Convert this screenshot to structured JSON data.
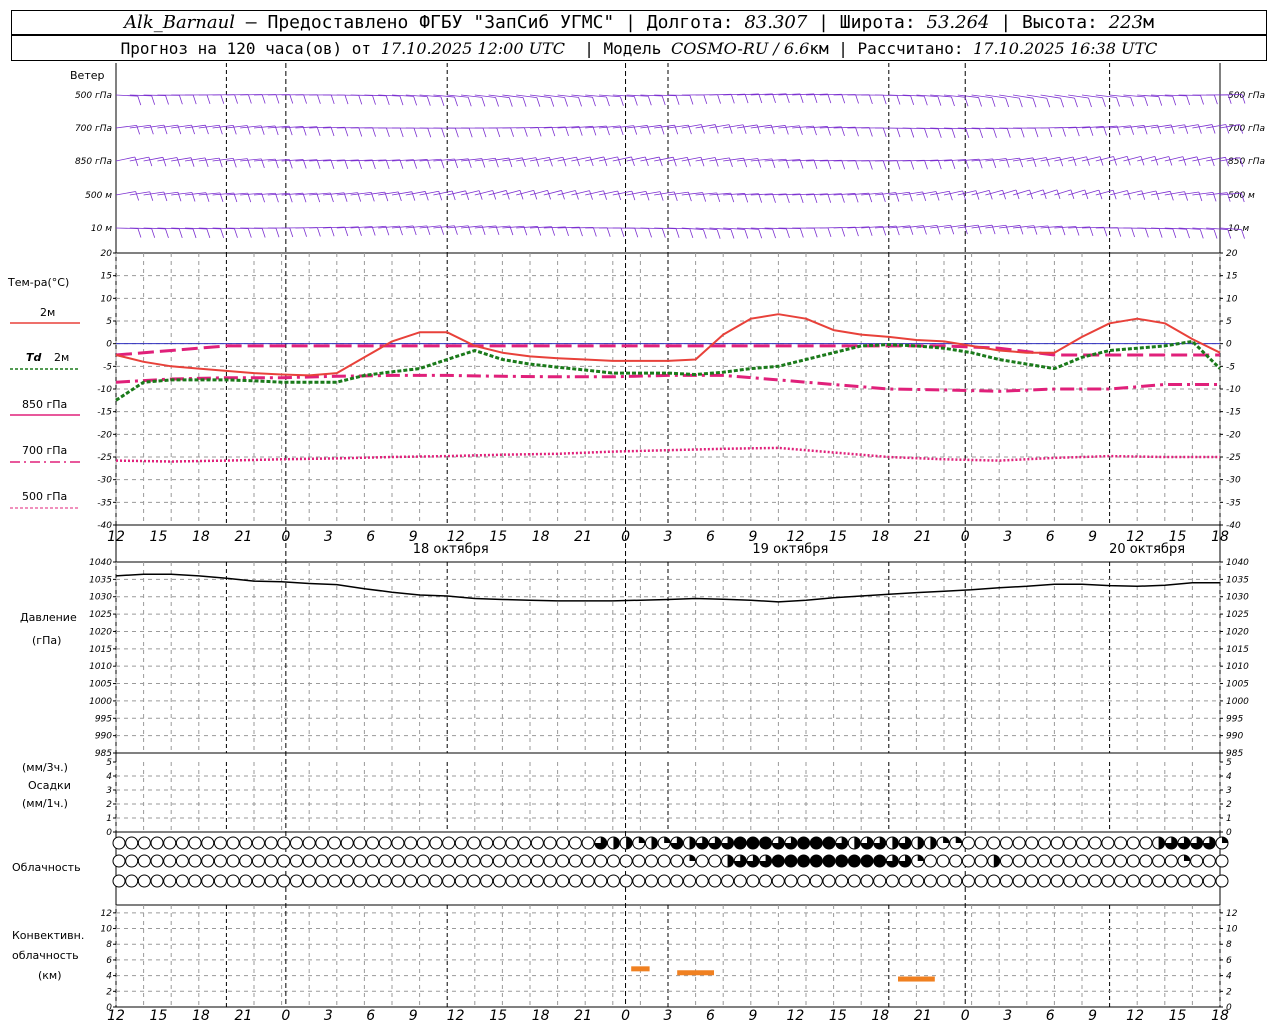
{
  "header": {
    "station": "Alk_Barnaul",
    "provider": " — Предоставлено ФГБУ \"ЗапСиб УГМС\" | Долгота: ",
    "lon": "83.307",
    "lat_label": " | Широта: ",
    "lat": "53.264",
    "alt_label": " | Высота: ",
    "alt": "223",
    "alt_unit": "м",
    "forecast_label": "Прогноз на 120 часа(ов) от ",
    "forecast_from": "17.10.2025 12:00 UTC",
    "model_label": "  | Модель ",
    "model": "COSMO-RU / 6.6",
    "model_unit": "км",
    "calc_label": " | Рассчитано: ",
    "calc_time": "17.10.2025 16:38 UTC"
  },
  "labels": {
    "wind": "Ветер",
    "wind_levels": [
      "500 гПа",
      "700 гПа",
      "850 гПа",
      "500 м",
      "10  м"
    ],
    "temp": "Тем-ра(°C)",
    "t2m": "2м",
    "td_a": "Td",
    "td_b": "2м",
    "t850": "850 гПа",
    "t700": "700 гПа",
    "t500": "500 гПа",
    "pressure": "Давление",
    "pressure_unit": "(гПа)",
    "precip_top": "(мм/3ч.)",
    "precip": "Осадки",
    "precip_unit": "(мм/1ч.)",
    "cloud": "Облачность",
    "conv1": "Конвективн.",
    "conv2": "облачность",
    "conv3": "(км)"
  },
  "colors": {
    "wind": "#7b2fd0",
    "t2m": "#e8413a",
    "td": "#1a7a1a",
    "t850": "#e0207a",
    "t700": "#e0207a",
    "t500": "#e0207a",
    "zero": "#3030c0",
    "pressure": "#000000",
    "conv": "#f08020"
  },
  "chart_data": {
    "type": "line",
    "x_hours": [
      12,
      15,
      18,
      21,
      0,
      3,
      6,
      9,
      12,
      15,
      18,
      21,
      0,
      3,
      6,
      9,
      12,
      15,
      18,
      21,
      0,
      3,
      6,
      9,
      12,
      15,
      18
    ],
    "dates": [
      "18 октября",
      "19 октября",
      "20 октября"
    ],
    "temperature": {
      "ylim": [
        -40,
        20
      ],
      "ticks": [
        20,
        15,
        10,
        5,
        0,
        -5,
        -10,
        -15,
        -20,
        -25,
        -30,
        -35,
        -40
      ],
      "series": [
        {
          "name": "2м",
          "x": [
            0,
            3,
            6,
            9,
            12,
            15,
            18,
            21,
            24,
            27,
            30,
            33,
            36,
            39,
            42,
            45,
            48,
            51,
            54,
            57,
            60,
            63,
            66,
            69,
            72,
            75,
            78,
            81,
            84,
            87,
            90,
            93,
            96,
            99,
            102,
            105,
            108,
            111,
            114,
            117,
            120
          ],
          "values": [
            -2.5,
            -4,
            -5,
            -5.5,
            -6,
            -6.5,
            -6.8,
            -7,
            -6.5,
            -3,
            0.5,
            2.5,
            2.5,
            -0.5,
            -2,
            -2.8,
            -3.2,
            -3.5,
            -3.8,
            -3.8,
            -3.8,
            -3.5,
            2,
            5.5,
            6.5,
            5.5,
            3,
            2,
            1.5,
            0.8,
            0.5,
            -0.5,
            -1.5,
            -2,
            -2,
            1.5,
            4.5,
            5.5,
            4.5,
            1,
            -2
          ]
        },
        {
          "name": "Td 2м",
          "x": [
            0,
            3,
            6,
            9,
            12,
            15,
            18,
            21,
            24,
            27,
            30,
            33,
            36,
            39,
            42,
            45,
            48,
            51,
            54,
            57,
            60,
            63,
            66,
            69,
            72,
            75,
            78,
            81,
            84,
            87,
            90,
            93,
            96,
            99,
            102,
            105,
            108,
            111,
            114,
            117,
            120
          ],
          "values": [
            -12.5,
            -8.5,
            -8,
            -8,
            -8,
            -8.2,
            -8.5,
            -8.5,
            -8.5,
            -7,
            -6.2,
            -5.5,
            -3.5,
            -1.5,
            -3.5,
            -4.5,
            -5.2,
            -5.8,
            -6.5,
            -6.5,
            -6.5,
            -6.8,
            -6.3,
            -5.5,
            -5,
            -3.5,
            -2,
            -0.5,
            -0.2,
            -0.5,
            -1,
            -2,
            -3.5,
            -4.5,
            -5.5,
            -3,
            -1.5,
            -1,
            -0.5,
            0.5,
            -5.5
          ]
        },
        {
          "name": "850 гПа",
          "x": [
            0,
            6,
            12,
            18,
            24,
            30,
            36,
            42,
            48,
            54,
            60,
            66,
            72,
            78,
            84,
            90,
            96,
            102,
            108,
            114,
            120
          ],
          "values": [
            -2.5,
            -1.5,
            -0.5,
            -0.5,
            -0.5,
            -0.5,
            -0.5,
            -0.5,
            -0.5,
            -0.5,
            -0.5,
            -0.5,
            -0.5,
            -0.5,
            -0.5,
            -0.5,
            -1,
            -2.5,
            -2.5,
            -2.5,
            -2.5
          ]
        },
        {
          "name": "700 гПа",
          "x": [
            0,
            6,
            12,
            18,
            24,
            30,
            36,
            42,
            48,
            54,
            60,
            66,
            72,
            78,
            84,
            90,
            96,
            102,
            108,
            114,
            120
          ],
          "values": [
            -8.5,
            -7.8,
            -7.5,
            -7.5,
            -7.2,
            -7,
            -7,
            -7.2,
            -7.3,
            -7.3,
            -7,
            -7,
            -8,
            -9,
            -10,
            -10.2,
            -10.5,
            -10,
            -10,
            -9,
            -9
          ]
        },
        {
          "name": "500 гПа",
          "x": [
            0,
            6,
            12,
            18,
            24,
            30,
            36,
            42,
            48,
            54,
            60,
            66,
            72,
            78,
            84,
            90,
            96,
            102,
            108,
            114,
            120
          ],
          "values": [
            -25.8,
            -26,
            -25.8,
            -25.5,
            -25.3,
            -25,
            -24.8,
            -24.5,
            -24.3,
            -23.8,
            -23.5,
            -23.2,
            -23,
            -24,
            -25,
            -25.5,
            -25.8,
            -25.2,
            -24.8,
            -25,
            -25
          ]
        }
      ]
    },
    "pressure": {
      "ylim": [
        985,
        1040
      ],
      "ticks": [
        1040,
        1035,
        1030,
        1025,
        1020,
        1015,
        1010,
        1005,
        1000,
        995,
        990,
        985
      ],
      "series": [
        {
          "name": "",
          "x": [
            0,
            3,
            6,
            9,
            12,
            15,
            18,
            21,
            24,
            27,
            30,
            33,
            36,
            39,
            42,
            45,
            48,
            51,
            54,
            57,
            60,
            63,
            66,
            69,
            72,
            75,
            78,
            81,
            84,
            87,
            90,
            93,
            96,
            99,
            102,
            105,
            108,
            111,
            114,
            117,
            120
          ],
          "values": [
            1036,
            1036.5,
            1036.5,
            1036,
            1035.3,
            1034.5,
            1034.3,
            1033.8,
            1033.5,
            1032.3,
            1031.3,
            1030.5,
            1030.2,
            1029.5,
            1029.2,
            1029,
            1028.8,
            1028.8,
            1028.8,
            1029,
            1029.2,
            1029.5,
            1029.3,
            1029,
            1028.5,
            1029,
            1029.7,
            1030.2,
            1030.7,
            1031.2,
            1031.6,
            1032,
            1032.6,
            1033,
            1033.6,
            1033.6,
            1033.2,
            1033,
            1033.3,
            1034,
            1034
          ]
        }
      ]
    },
    "precip": {
      "ylim": [
        0,
        5
      ],
      "ticks": [
        5,
        4,
        3,
        2,
        1,
        0
      ]
    },
    "convective": {
      "ylim": [
        0,
        13
      ],
      "ticks": [
        12,
        10,
        8,
        6,
        4,
        2,
        0
      ],
      "segments": [
        {
          "x0": 56,
          "x1": 58,
          "y": 4.8
        },
        {
          "x0": 61,
          "x1": 65,
          "y": 4.3
        },
        {
          "x0": 85,
          "x1": 89,
          "y": 3.5
        }
      ]
    },
    "clouds": {
      "rows": 3,
      "count": 81,
      "upper": [
        0,
        0,
        0,
        0,
        0,
        0,
        0,
        0,
        0,
        0,
        0,
        0,
        0,
        0,
        0,
        0,
        0,
        0,
        0,
        0,
        0,
        0,
        0,
        0,
        0,
        0,
        0,
        0,
        0,
        0,
        0,
        0,
        0,
        0,
        0,
        0,
        0,
        0,
        3,
        2,
        2,
        1,
        2,
        1,
        3,
        2,
        3,
        3,
        3,
        4,
        4,
        4,
        3,
        3,
        4,
        4,
        4,
        3,
        2,
        3,
        3,
        2,
        3,
        2,
        2,
        1,
        1,
        0,
        0,
        0,
        0,
        0,
        0,
        0,
        0,
        0,
        0,
        0,
        0,
        0,
        0,
        0,
        2,
        3,
        3,
        3,
        3,
        1,
        3,
        3,
        2
      ],
      "middle": [
        0,
        0,
        0,
        0,
        0,
        0,
        0,
        0,
        0,
        0,
        0,
        0,
        0,
        0,
        0,
        0,
        0,
        0,
        0,
        0,
        0,
        0,
        0,
        0,
        0,
        0,
        0,
        0,
        0,
        0,
        0,
        0,
        0,
        0,
        0,
        0,
        0,
        0,
        0,
        0,
        0,
        0,
        0,
        0,
        0,
        1,
        0,
        0,
        2,
        3,
        3,
        3,
        4,
        4,
        4,
        4,
        4,
        4,
        4,
        4,
        4,
        3,
        3,
        1,
        0,
        0,
        0,
        0,
        0,
        2,
        0,
        0,
        0,
        0,
        0,
        0,
        0,
        0,
        0,
        0,
        0,
        0,
        0,
        0,
        1,
        0,
        0,
        0,
        0,
        0,
        0,
        0
      ],
      "lower": []
    },
    "wind_barbs": {
      "levels": [
        "500 гПа",
        "700 гПа",
        "850 гПа",
        "500 м",
        "10  м"
      ]
    }
  }
}
